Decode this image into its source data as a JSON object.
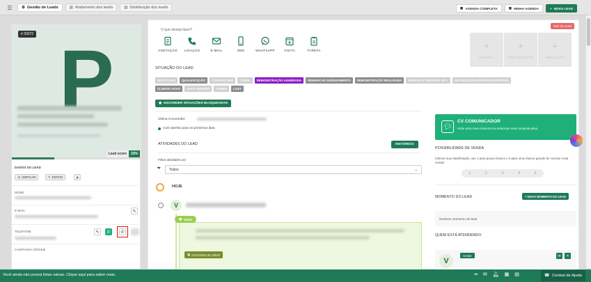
{
  "topbar": {
    "tabs": [
      {
        "label": "Gestão de Leads",
        "active": true
      },
      {
        "label": "Andamento dos leads",
        "active": false
      },
      {
        "label": "Distribuição dos leads",
        "active": false
      }
    ],
    "buttons": [
      "AGENDA COMPLETA",
      "MINHA AGENDA",
      "NOVO LEAD"
    ]
  },
  "lead": {
    "number": "# 30372",
    "initial": "P",
    "score_label": "Lead score",
    "score_value": "33%",
    "score_fraction": 0.33,
    "dados_label": "DADOS DO LEAD",
    "unificar": "UNIFICAR",
    "editar": "EDITAR",
    "nome_label": "NOME",
    "email_label": "E-MAIL",
    "telefone_label": "TELEFONE",
    "campanha_label": "CAMPANHA ORIGEM"
  },
  "main": {
    "question": "O que deseja fazer?",
    "sair_lead": "Sair do Lead",
    "actions": [
      "ANOTAÇÃO",
      "LIGAÇÃO",
      "E-MAIL",
      "SMS",
      "WHATSAPP",
      "VISITA",
      "TAREFA"
    ],
    "disabled_actions": [
      "RESERVA",
      "PRÉ CADASTRO",
      "SIMULAÇÃO"
    ],
    "situacao_title": "SITUAÇÃO DO LEAD",
    "tags": [
      {
        "label": "NOVO LEAD",
        "style": "light"
      },
      {
        "label": "QUALIFICAÇÃO",
        "style": "dark"
      },
      {
        "label": "CONTATO SDR",
        "style": "light"
      },
      {
        "label": "CANAL",
        "style": "light"
      },
      {
        "label": "DEMONSTRAÇÃO AGENDADA",
        "style": "purple"
      },
      {
        "label": "REMARCAR AGENDAMENTO",
        "style": "dark"
      },
      {
        "label": "DEMONSTRAÇÃO REALIZADA",
        "style": "dark"
      },
      {
        "label": "MARCAR 2ª REUNIÃO OK +",
        "style": "light"
      },
      {
        "label": "NEGOCIAÇÃO (PROPOSTA EMITIDA)",
        "style": "light"
      },
      {
        "label": "CLIENTE ATIVO",
        "style": "dark"
      },
      {
        "label": "LEAD VENCIDO",
        "style": "light"
      },
      {
        "label": "CHURN",
        "style": "light"
      },
      {
        "label": "LOST",
        "style": "dark"
      }
    ],
    "hide_button": "ESCONDER SITUAÇÕES BLOQUEADAS",
    "ultima_conversao": "Última Conversão:",
    "tarefas_text": "Com tarefas para os próximos dias.",
    "atividades_title": "ATIVIDADES DO LEAD",
    "historico": "HISTÓRICO",
    "filtrar_label": "Filtrar atividades por:",
    "filter_value": "Todos",
    "hoje": "HOJE",
    "visita_label": "Visita",
    "visita_date": "21/11/2024 às 10h30"
  },
  "right": {
    "cv_title": "CV COMUNICADOR",
    "cv_desc": "Inicie uma nova conversa ou selecione uma conversa ativa.",
    "possibilidade_title": "POSSIBILIDADE DE VENDA",
    "possibilidade_desc": "Informe sua classificação, use 1 para pouca chance e 5 para uma chance grande de concluir essa venda!",
    "ratings": [
      "1",
      "2",
      "3",
      "4",
      "5"
    ],
    "momento_title": "MOMENTO DO LEAD",
    "momento_button": "+ NOVO MOMENTO DO LEAD",
    "momento_empty": "Nenhum momento do lead",
    "atendendo_title": "QUEM ESTÁ ATENDENDO",
    "gestor_badge": "Gestor"
  },
  "footer": {
    "message": "Você ainda não possui listas salvas. Clique aqui para saber mais.",
    "help": "Central de Ajuda"
  },
  "colors": {
    "brand_green": "#1f7a57",
    "purple_tag": "#8a1fc4",
    "cv_green": "#1fb07a"
  }
}
